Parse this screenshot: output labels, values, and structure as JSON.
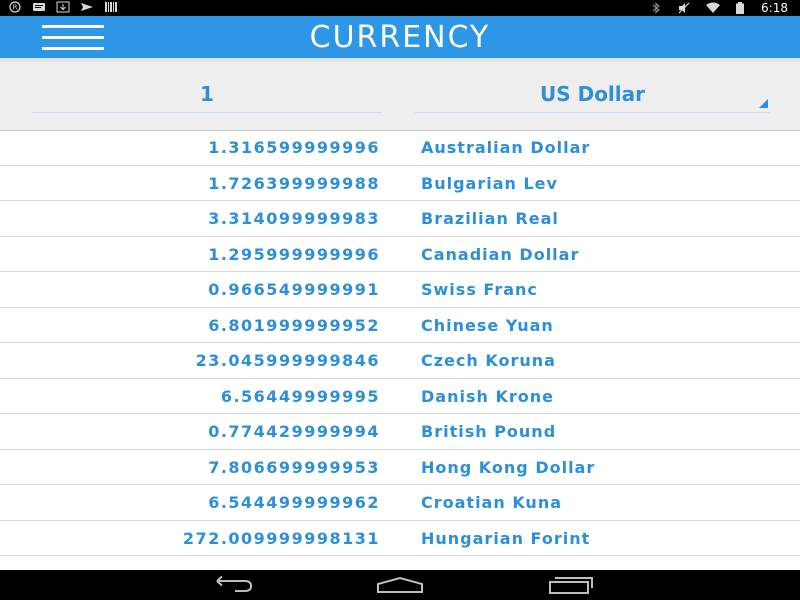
{
  "status_bar": {
    "left_icons": [
      "registered-icon",
      "chat-icon",
      "download-icon",
      "send-icon",
      "barcode-icon"
    ],
    "right_icons": [
      "bluetooth-icon",
      "mute-icon",
      "wifi-icon",
      "battery-icon"
    ],
    "time": "6:18"
  },
  "app_bar": {
    "title": "CURRENCY",
    "menu_icon": "hamburger-menu-icon"
  },
  "converter": {
    "amount": "1",
    "selected_currency": "US Dollar"
  },
  "rates": [
    {
      "value": "1.316599999996",
      "name": "Australian Dollar"
    },
    {
      "value": "1.726399999988",
      "name": "Bulgarian Lev"
    },
    {
      "value": "3.314099999983",
      "name": "Brazilian Real"
    },
    {
      "value": "1.295999999996",
      "name": "Canadian Dollar"
    },
    {
      "value": "0.966549999991",
      "name": "Swiss Franc"
    },
    {
      "value": "6.801999999952",
      "name": "Chinese Yuan"
    },
    {
      "value": "23.045999999846",
      "name": "Czech Koruna"
    },
    {
      "value": "6.56449999995",
      "name": "Danish Krone"
    },
    {
      "value": "0.774429999994",
      "name": "British Pound"
    },
    {
      "value": "7.806699999953",
      "name": "Hong Kong Dollar"
    },
    {
      "value": "6.544499999962",
      "name": "Croatian Kuna"
    },
    {
      "value": "272.009999998131",
      "name": "Hungarian Forint"
    },
    {
      "value": "",
      "name": ""
    }
  ],
  "nav_bar": {
    "icons": [
      "back-icon",
      "home-icon",
      "recent-apps-icon"
    ]
  },
  "colors": {
    "accent": "#2e96e6",
    "text_blue": "#2e8fd9"
  }
}
